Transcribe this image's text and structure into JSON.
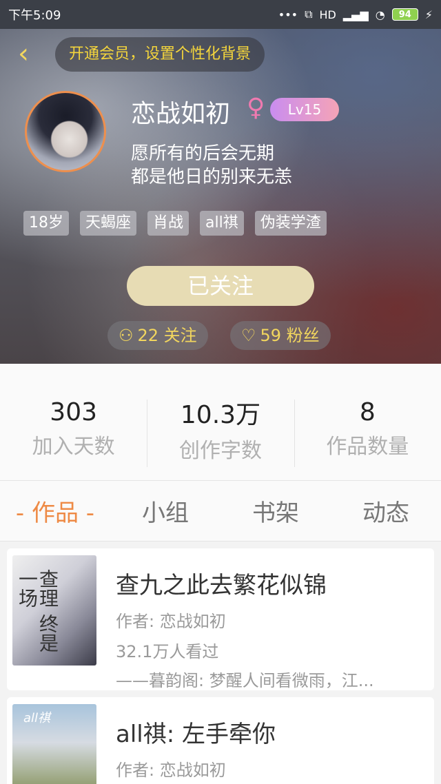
{
  "status": {
    "time": "下午5:09",
    "signal": "HD",
    "battery": "94"
  },
  "header": {
    "vip_banner": "开通会员，设置个性化背景",
    "username": "恋战如初",
    "gender_symbol": "♀",
    "level": "Lv15",
    "bio_line1": "愿所有的后会无期",
    "bio_line2": "都是他日的别来无恙",
    "tags": [
      "18岁",
      "天蝎座",
      "肖战",
      "all祺",
      "伪装学渣"
    ],
    "follow_button": "已关注",
    "following_label": "22 关注",
    "fans_label": "59 粉丝"
  },
  "stats": [
    {
      "value": "303",
      "label": "加入天数"
    },
    {
      "value": "10.3万",
      "label": "创作字数"
    },
    {
      "value": "8",
      "label": "作品数量"
    }
  ],
  "tabs": [
    "- 作品 -",
    "小组",
    "书架",
    "动态"
  ],
  "works": [
    {
      "title": "查九之此去繁花似锦",
      "author": "作者: 恋战如初",
      "views": "32.1万人看过",
      "desc": "——暮韵阁: 梦醒人间看微雨，江...",
      "cover_text": "查理 终是一场"
    },
    {
      "title": "all祺: 左手牵你",
      "author": "作者: 恋战如初",
      "cover_text": "all祺"
    }
  ],
  "colors": {
    "accent": "#ee8a45",
    "gold": "#f2d65e",
    "follow_button_bg": "#e7dcb4"
  }
}
